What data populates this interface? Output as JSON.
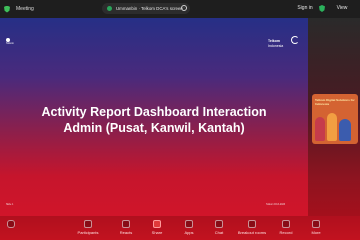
{
  "topbar": {
    "meeting_title": "Meeting",
    "share_text": "Ummanbin · Telkom DCA's screen",
    "sign_in": "Sign in",
    "view": "View"
  },
  "slide": {
    "title_line1": "Activity Report Dashboard Interaction",
    "title_line2": "Admin (Pusat, Kanwil, Kantah)",
    "logo_left_text": "Telkom",
    "logo_right_line1": "Telkom",
    "logo_right_line2": "Indonesia",
    "footer_left": "Slide 1",
    "footer_right": "Telkom DCA 2023"
  },
  "side_panel": {
    "thumbnail_text": "Telkom Digital Solutions for Indonesia"
  },
  "toolbar": {
    "items": [
      {
        "label": "Participants",
        "icon": "participants-icon"
      },
      {
        "label": "Reacts",
        "icon": "reactions-icon"
      },
      {
        "label": "Share",
        "icon": "share-icon"
      },
      {
        "label": "Apps",
        "icon": "apps-icon"
      },
      {
        "label": "Chat",
        "icon": "chat-icon"
      },
      {
        "label": "Breakout rooms",
        "icon": "breakout-rooms-icon"
      },
      {
        "label": "Record",
        "icon": "record-icon"
      },
      {
        "label": "More",
        "icon": "more-icon"
      }
    ]
  }
}
